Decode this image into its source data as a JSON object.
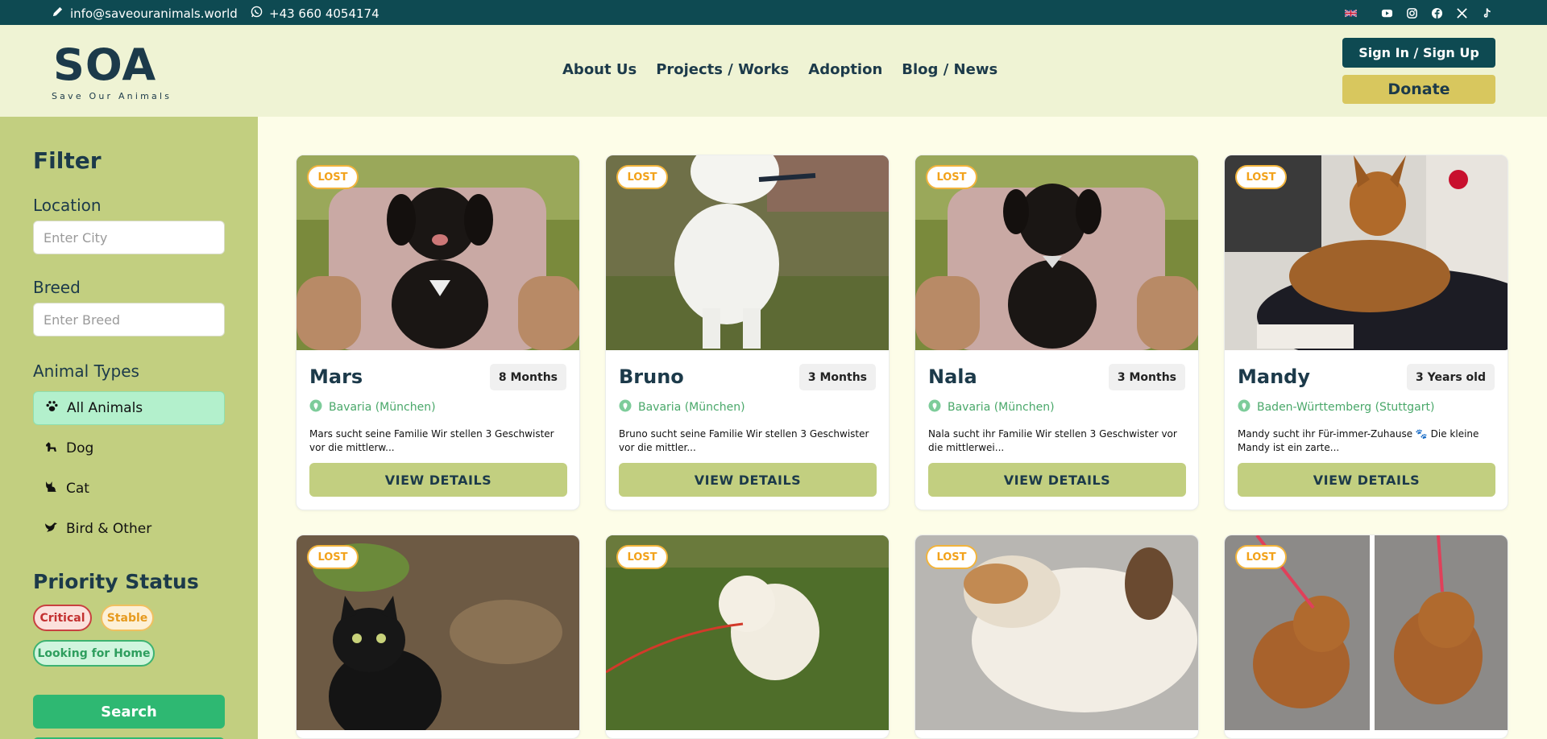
{
  "topbar": {
    "email": "info@saveouranimals.world",
    "phone": "+43 660 4054174",
    "social_icons": [
      "uk-flag-icon",
      "youtube-icon",
      "instagram-icon",
      "facebook-icon",
      "x-icon",
      "tiktok-icon"
    ]
  },
  "header": {
    "logo_text": "SOA",
    "logo_tagline": "Save Our Animals",
    "nav": [
      "About Us",
      "Projects / Works",
      "Adoption",
      "Blog / News"
    ],
    "sign_in_label": "Sign In / Sign Up",
    "donate_label": "Donate"
  },
  "colors": {
    "topbar": "#0e4a52",
    "header": "#eff3d4",
    "sidebar": "#c2cf80",
    "accent_green": "#2eb872",
    "lost_badge": "#f2a21b",
    "donate": "#d8c75e"
  },
  "sidebar": {
    "title": "Filter",
    "location_label": "Location",
    "location_placeholder": "Enter City",
    "breed_label": "Breed",
    "breed_placeholder": "Enter Breed",
    "types_title": "Animal Types",
    "types": [
      {
        "label": "All Animals",
        "icon": "paw-icon",
        "active": true
      },
      {
        "label": "Dog",
        "icon": "dog-icon",
        "active": false
      },
      {
        "label": "Cat",
        "icon": "cat-icon",
        "active": false
      },
      {
        "label": "Bird & Other",
        "icon": "bird-icon",
        "active": false
      }
    ],
    "priority_title": "Priority Status",
    "priority": [
      "Critical",
      "Stable",
      "Looking for Home"
    ],
    "search_label": "Search"
  },
  "cards": [
    {
      "status": "LOST",
      "name": "Mars",
      "age": "8 Months",
      "location": "Bavaria (München)",
      "description": "Mars sucht seine Familie Wir stellen 3 Geschwister vor die mittlerw...",
      "button": "VIEW DETAILS"
    },
    {
      "status": "LOST",
      "name": "Bruno",
      "age": "3 Months",
      "location": "Bavaria (München)",
      "description": "Bruno sucht seine Familie Wir stellen 3 Geschwister vor die mittler...",
      "button": "VIEW DETAILS"
    },
    {
      "status": "LOST",
      "name": "Nala",
      "age": "3 Months",
      "location": "Bavaria (München)",
      "description": "Nala sucht ihr Familie Wir stellen 3 Geschwister vor die mittlerwei...",
      "button": "VIEW DETAILS"
    },
    {
      "status": "LOST",
      "name": "Mandy",
      "age": "3 Years old",
      "location": "Baden-Württemberg (Stuttgart)",
      "description": "Mandy sucht ihr Für-immer-Zuhause 🐾 Die kleine Mandy ist ein zarte...",
      "button": "VIEW DETAILS"
    },
    {
      "status": "LOST"
    },
    {
      "status": "LOST"
    },
    {
      "status": "LOST"
    },
    {
      "status": "LOST"
    }
  ]
}
